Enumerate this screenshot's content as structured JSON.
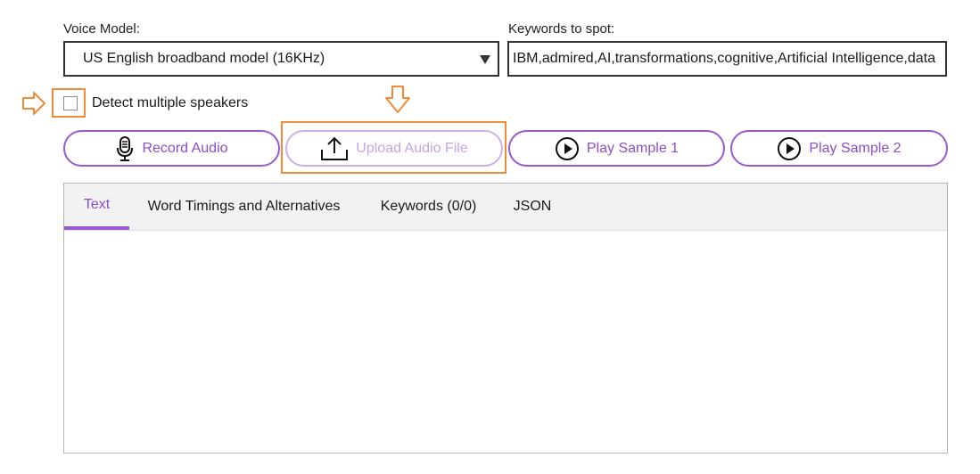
{
  "voice_model": {
    "label": "Voice Model:",
    "selected": "US English broadband model (16KHz)"
  },
  "keywords": {
    "label": "Keywords to spot:",
    "value": "IBM,admired,AI,transformations,cognitive,Artificial Intelligence,data"
  },
  "speakers": {
    "label": "Detect multiple speakers",
    "checked": false
  },
  "buttons": {
    "record": "Record Audio",
    "upload": "Upload Audio File",
    "sample1": "Play Sample 1",
    "sample2": "Play Sample 2"
  },
  "tabs": [
    {
      "label": "Text",
      "active": true
    },
    {
      "label": "Word Timings and Alternatives",
      "active": false
    },
    {
      "label": "Keywords (0/0)",
      "active": false
    },
    {
      "label": "JSON",
      "active": false
    }
  ],
  "icons": {
    "record": "microphone-icon",
    "upload": "upload-icon",
    "sample1": "play-circle-icon",
    "sample2": "play-circle-icon",
    "select_caret": "caret-down-icon",
    "pointer_left": "arrow-right-outline-icon",
    "pointer_top": "arrow-down-outline-icon"
  },
  "colors": {
    "accent": "#9b59d0",
    "accent_text": "#8a4fc6",
    "highlight": "#ef8b3a",
    "border": "#323232"
  }
}
